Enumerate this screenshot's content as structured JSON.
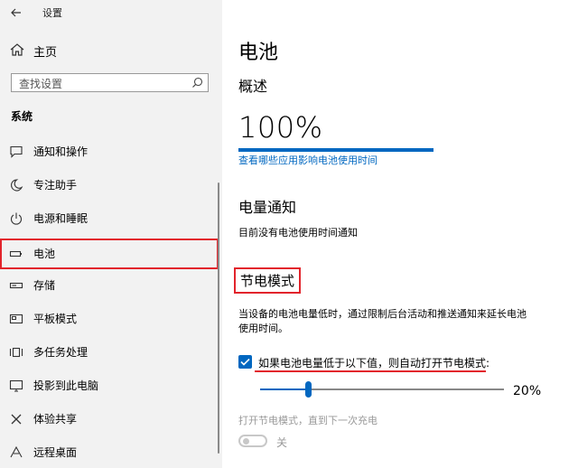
{
  "window": {
    "title": "设置"
  },
  "sidebar": {
    "home_label": "主页",
    "search_placeholder": "查找设置",
    "section_title": "系统",
    "items": [
      {
        "label": "通知和操作",
        "icon": "notification-icon"
      },
      {
        "label": "专注助手",
        "icon": "moon-icon"
      },
      {
        "label": "电源和睡眠",
        "icon": "power-icon"
      },
      {
        "label": "电池",
        "icon": "battery-icon",
        "active": true
      },
      {
        "label": "存储",
        "icon": "storage-icon"
      },
      {
        "label": "平板模式",
        "icon": "tablet-icon"
      },
      {
        "label": "多任务处理",
        "icon": "multitask-icon"
      },
      {
        "label": "投影到此电脑",
        "icon": "project-icon"
      },
      {
        "label": "体验共享",
        "icon": "share-icon"
      },
      {
        "label": "远程桌面",
        "icon": "remote-desktop-icon"
      }
    ]
  },
  "main": {
    "title": "电池",
    "overview": {
      "heading": "概述",
      "percent": "100%",
      "percent_fraction": 1.0,
      "link": "查看哪些应用影响电池使用时间"
    },
    "notification": {
      "heading": "电量通知",
      "text": "目前没有电池使用时间通知"
    },
    "saver": {
      "heading": "节电模式",
      "description_line1": "当设备的电池电量低时，通过限制后台活动和推送通知来延长电池",
      "description_line2": "使用时间。",
      "checkbox_label": "如果电池电量低于以下值，则自动打开节电模式:",
      "checkbox_checked": true,
      "slider_value": "20%",
      "slider_fraction": 0.2,
      "toggle_heading": "打开节电模式，直到下一次充电",
      "toggle_state": "关"
    }
  },
  "colors": {
    "accent": "#0067c0",
    "highlight": "#e2242c"
  }
}
